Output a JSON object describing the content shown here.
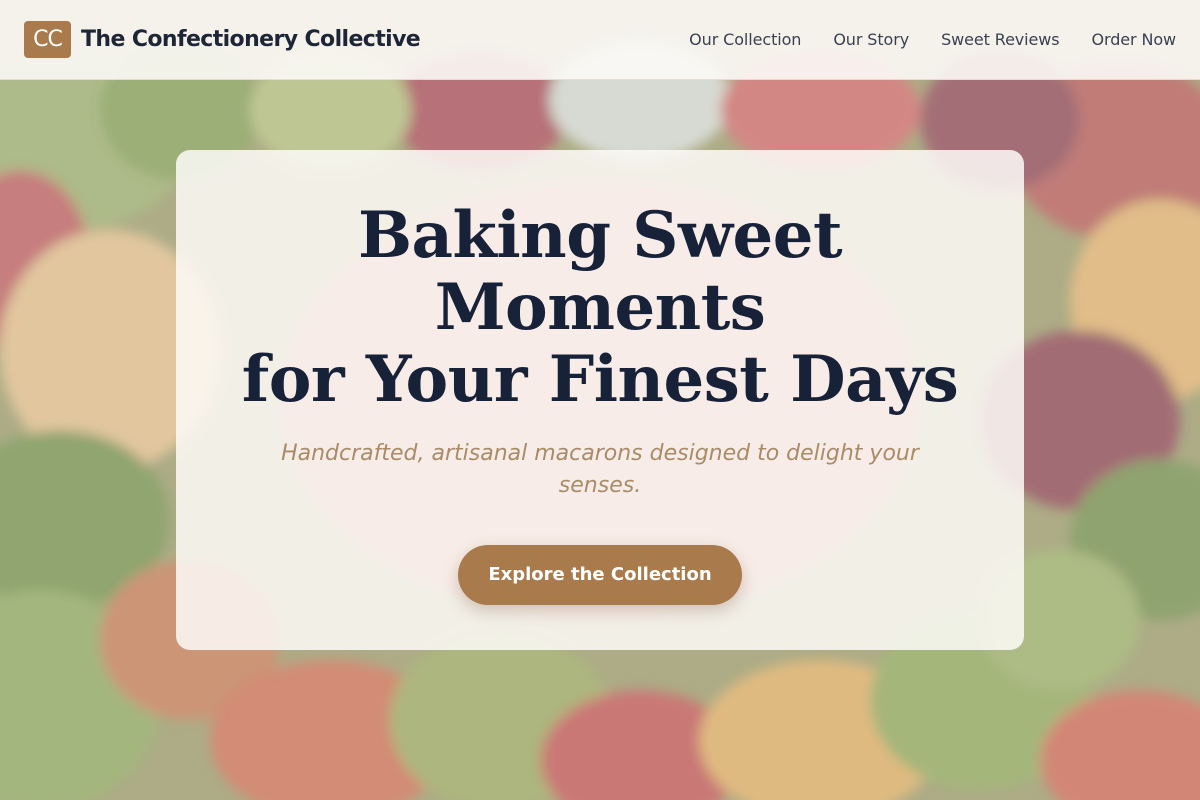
{
  "brand": {
    "logo_text": "CC",
    "name": "The Confectionery Collective"
  },
  "nav": {
    "items": [
      {
        "label": "Our Collection"
      },
      {
        "label": "Our Story"
      },
      {
        "label": "Sweet Reviews"
      },
      {
        "label": "Order Now"
      }
    ]
  },
  "hero": {
    "title_lines": [
      "Baking Sweet",
      "Moments",
      "for Your Finest Days"
    ],
    "subtitle": "Handcrafted, artisanal macarons designed to delight your senses.",
    "cta_label": "Explore the Collection",
    "background": "gummy bears photo"
  },
  "colors": {
    "accent": "#a87a4c",
    "heading": "#172238",
    "subtitle": "#a98b68"
  }
}
